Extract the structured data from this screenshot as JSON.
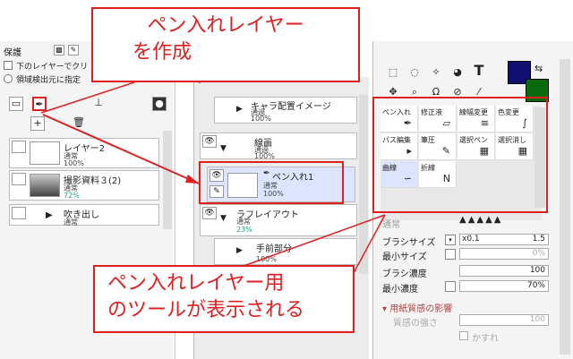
{
  "left_panel": {
    "protect_label": "保護",
    "clip_label": "下のレイヤーでクリ",
    "detect_label": "領域検出元に指定",
    "layers": [
      {
        "name": "レイヤー2",
        "mode": "通常",
        "opacity": "100%"
      },
      {
        "name": "撮影資料３(2)",
        "mode": "通常",
        "opacity": "72%"
      },
      {
        "name": "吹き出し",
        "mode": "通常",
        "opacity": ""
      }
    ]
  },
  "middle_panel": {
    "layers": [
      {
        "name": "キャラ配置イメージ",
        "mode": "通過",
        "opacity": "100%"
      },
      {
        "name": "線画",
        "mode": "通過",
        "opacity": "100%"
      },
      {
        "name": "ペン入れ1",
        "mode": "通常",
        "opacity": "100%"
      },
      {
        "name": "ラフレイアウト",
        "mode": "通常",
        "opacity": "23%"
      },
      {
        "name": "手前部分",
        "mode": "",
        "opacity": "100%"
      }
    ]
  },
  "tools": [
    {
      "label": "ペン入れ",
      "icon": "pen-icon",
      "glyph": "✒"
    },
    {
      "label": "修正液",
      "icon": "eraser-icon",
      "glyph": "▱"
    },
    {
      "label": "線幅変更",
      "icon": "linewidth-icon",
      "glyph": "≡"
    },
    {
      "label": "色変更",
      "icon": "color-change-icon",
      "glyph": "∫"
    },
    {
      "label": "パス編集",
      "icon": "path-edit-icon",
      "glyph": "▸"
    },
    {
      "label": "筆圧",
      "icon": "pressure-icon",
      "glyph": "✎"
    },
    {
      "label": "選択ペン",
      "icon": "select-pen-icon",
      "glyph": "▦"
    },
    {
      "label": "選択消し",
      "icon": "select-erase-icon",
      "glyph": "▦"
    },
    {
      "label": "曲線",
      "icon": "curve-icon",
      "glyph": "∽"
    },
    {
      "label": "折線",
      "icon": "polyline-icon",
      "glyph": "N"
    }
  ],
  "settings": {
    "mode_label": "通常",
    "brush_size_label": "ブラシサイズ",
    "brush_size_mult": "x0.1",
    "brush_size_value": "1.5",
    "min_size_label": "最小サイズ",
    "min_size_value": "0%",
    "brush_density_label": "ブラシ濃度",
    "brush_density_value": "100",
    "min_density_label": "最小濃度",
    "min_density_value": "70%",
    "paper_label": "用紙質感の影響",
    "texture_strength_label": "質感の強さ",
    "texture_strength_value": "100",
    "kasure_label": "かすれ"
  },
  "colors": {
    "primary": "#101070",
    "secondary": "#0a6a10",
    "accent": "#e02020"
  },
  "callout_top": [
    "ペン入れレイヤー",
    "を作成"
  ],
  "callout_bottom": [
    "ペン入れレイヤー用",
    "のツールが表示される"
  ]
}
